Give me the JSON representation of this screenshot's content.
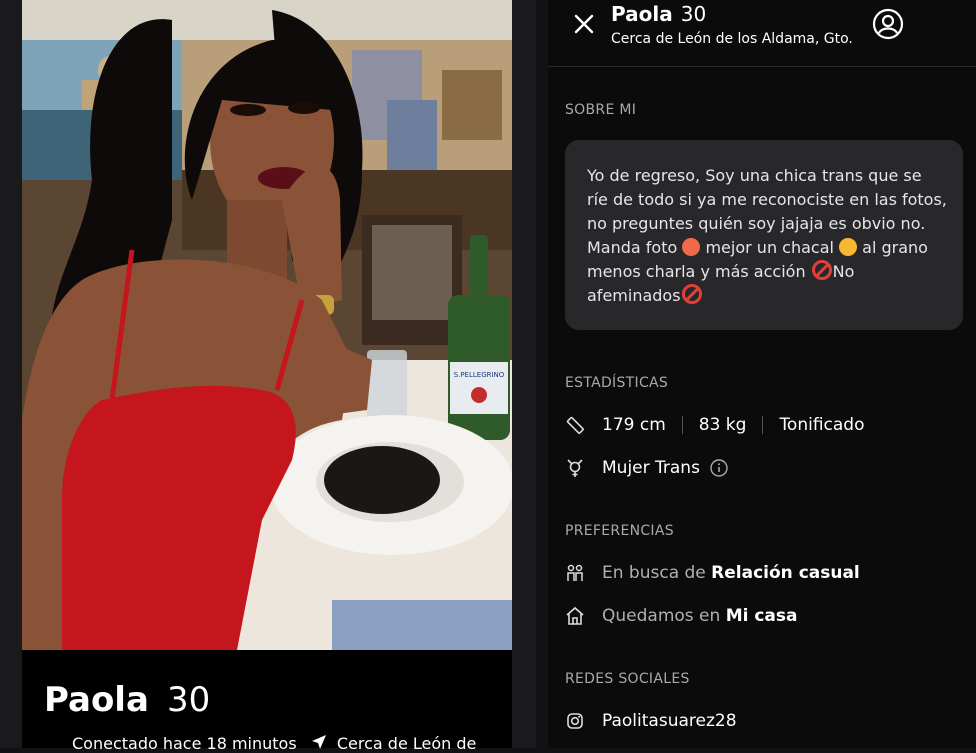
{
  "profile": {
    "name": "Paola",
    "age": "30",
    "status": "Conectado hace 18 minutos",
    "location_short": "Cerca de León de",
    "location": "Cerca de León de los Aldama, Gto."
  },
  "sections": {
    "about": "SOBRE MI",
    "stats": "ESTADÍSTICAS",
    "preferences": "PREFERENCIAS",
    "social": "REDES SOCIALES"
  },
  "bio": {
    "part1": "Yo de regreso, Soy una chica trans que se ríe de todo si ya me reconociste en las fotos, no preguntes quién soy jajaja es obvio no. Manda foto",
    "part2": "mejor un chacal",
    "part3": "al grano menos charla y más acción",
    "part4": "No afeminados"
  },
  "stats": {
    "height": "179 cm",
    "weight": "83 kg",
    "body": "Tonificado",
    "identity": "Mujer Trans"
  },
  "preferences": {
    "looking_prefix": "En busca de",
    "looking_value": "Relación casual",
    "meet_prefix": "Quedamos en",
    "meet_value": "Mi casa"
  },
  "social": {
    "instagram": "Paolitasuarez28"
  },
  "photo": {
    "bottle_label": "S.PELLEGRINO",
    "icon": "photo"
  },
  "colors": {
    "bg": "#0b0b0c",
    "card": "#28282b",
    "muted": "#a9a9ad",
    "dress": "#c4161c"
  }
}
